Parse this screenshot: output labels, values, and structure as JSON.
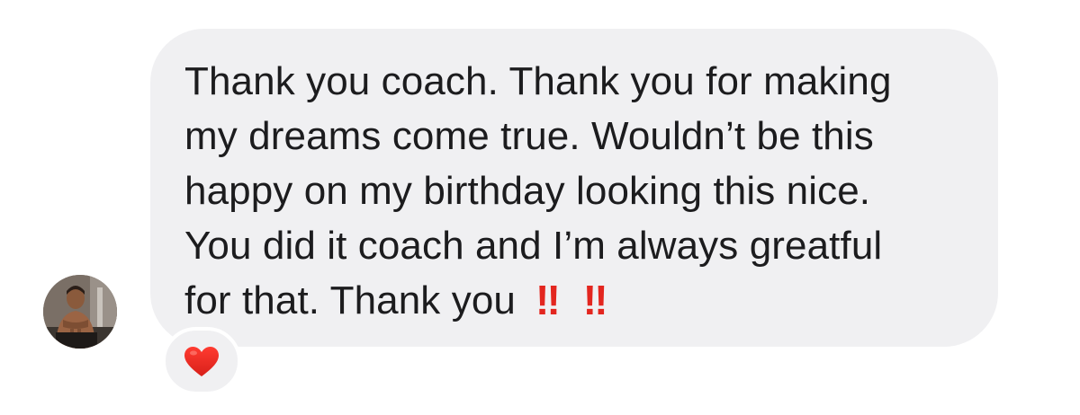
{
  "message": {
    "lines": [
      "Thank you coach. Thank you for making",
      "my dreams come true. Wouldn’t be this",
      "happy on my birthday looking this nice.",
      "You did it coach and I’m always greatful",
      "for that. Thank you"
    ],
    "emoji_1": "‼",
    "emoji_2": "‼"
  },
  "reaction": {
    "icon": "red-heart-icon",
    "color": "#e3261f"
  },
  "sender": {
    "avatar_icon": "avatar"
  },
  "colors": {
    "bubble": "#f0f0f2",
    "text": "#1c1c1e",
    "accent_red": "#e3261f"
  }
}
